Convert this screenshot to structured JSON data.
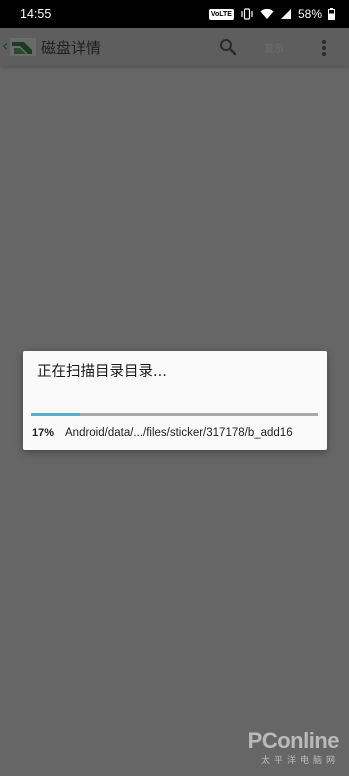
{
  "status_bar": {
    "time": "14:55",
    "volte": "VoLTE",
    "battery_percent": "58%",
    "icons": [
      "vibrate-icon",
      "wifi-icon",
      "signal-icon",
      "battery-icon"
    ]
  },
  "app_bar": {
    "title": "磁盘详情",
    "display_label": "显示",
    "icons": [
      "back-chevron-icon",
      "app-logo-icon",
      "search-icon",
      "overflow-menu-icon"
    ]
  },
  "dialog": {
    "title": "正在扫描目录目录...",
    "progress_fraction": 0.17,
    "progress_percent": "17%",
    "current_path": "Android/data/.../files/sticker/317178/b_add16",
    "colors": {
      "track": "#a9a9a9",
      "fill": "#5aaccf"
    }
  },
  "watermark": {
    "brand": "PConline",
    "subtitle": "太平洋电脑网"
  }
}
